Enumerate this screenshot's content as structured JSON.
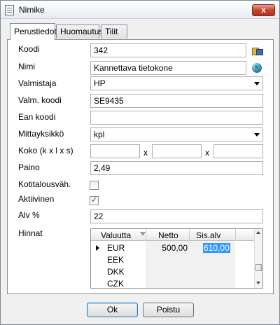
{
  "window": {
    "title": "Nimike",
    "close_glyph": "x"
  },
  "tabs": [
    {
      "label": "Perustiedot",
      "active": true
    },
    {
      "label": "Huomautus",
      "active": false
    },
    {
      "label": "Tilit",
      "active": false
    }
  ],
  "form": {
    "koodi": {
      "label": "Koodi",
      "value": "342",
      "icon": "lookup-icon"
    },
    "nimi": {
      "label": "Nimi",
      "value": "Kannettava tietokone",
      "icon": "globe-icon"
    },
    "valmistaja": {
      "label": "Valmistaja",
      "value": "HP"
    },
    "valm_koodi": {
      "label": "Valm. koodi",
      "value": "SE9435"
    },
    "ean_koodi": {
      "label": "Ean koodi",
      "value": ""
    },
    "mittayksikko": {
      "label": "Mittayksikkö",
      "value": "kpl"
    },
    "koko": {
      "label": "Koko (k x l x s)",
      "sep1": "x",
      "sep2": "x",
      "k": "",
      "l": "",
      "s": ""
    },
    "paino": {
      "label": "Paino",
      "value": "2,49"
    },
    "kotitalousvah": {
      "label": "Kotitalousväh.",
      "checked": false
    },
    "aktiivinen": {
      "label": "Aktiivinen",
      "checked": true,
      "check_glyph": "✓"
    },
    "alv": {
      "label": "Alv %",
      "value": "22"
    },
    "hinnat": {
      "label": "Hinnat"
    }
  },
  "prices": {
    "columns": [
      "Valuutta",
      "Netto",
      "Sis.alv"
    ],
    "rows": [
      {
        "currency": "EUR",
        "netto": "500,00",
        "sis_alv": "610,00",
        "current": true
      },
      {
        "currency": "EEK",
        "netto": "",
        "sis_alv": ""
      },
      {
        "currency": "DKK",
        "netto": "",
        "sis_alv": ""
      },
      {
        "currency": "CZK",
        "netto": "",
        "sis_alv": ""
      }
    ]
  },
  "buttons": {
    "ok": "Ok",
    "poistu": "Poistu"
  }
}
